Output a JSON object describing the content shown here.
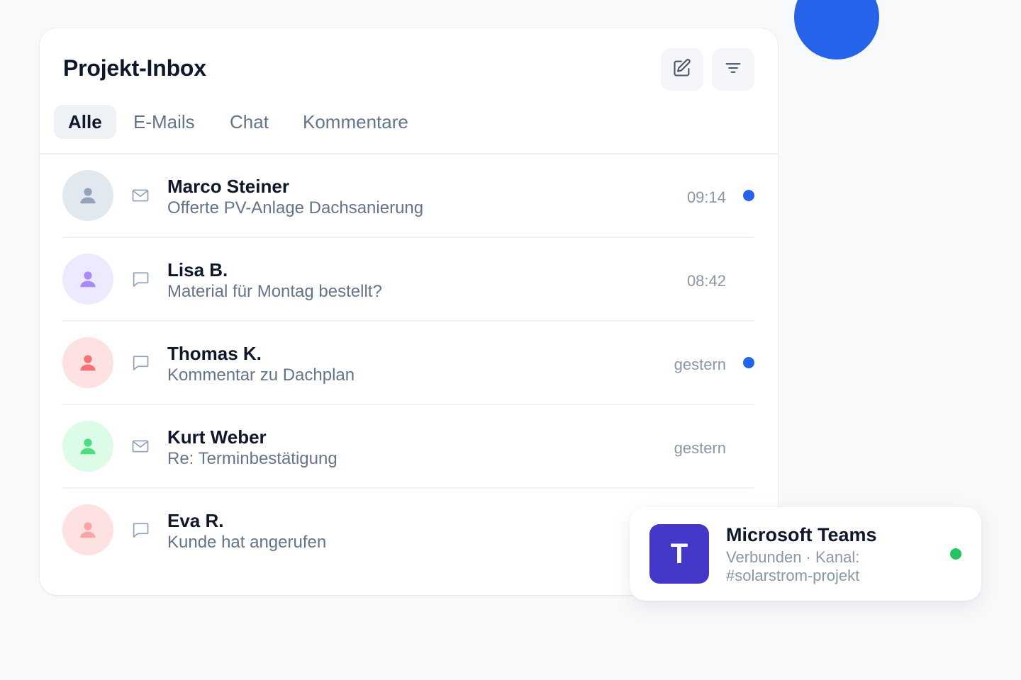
{
  "header": {
    "title": "Projekt-Inbox",
    "compose_icon": "compose-icon",
    "filter_icon": "filter-icon"
  },
  "tabs": [
    {
      "label": "Alle",
      "active": true
    },
    {
      "label": "E-Mails",
      "active": false
    },
    {
      "label": "Chat",
      "active": false
    },
    {
      "label": "Kommentare",
      "active": false
    }
  ],
  "messages": [
    {
      "name": "Marco Steiner",
      "subject": "Offerte PV-Anlage Dachsanierung",
      "time": "09:14",
      "unread": true,
      "type": "email",
      "type_icon": "mail-icon",
      "avatar_bg": "#e2e8f0",
      "avatar_fg": "#94a3b8"
    },
    {
      "name": "Lisa B.",
      "subject": "Material für Montag bestellt?",
      "time": "08:42",
      "unread": false,
      "type": "chat",
      "type_icon": "chat-bubble-icon",
      "avatar_bg": "#ede9fe",
      "avatar_fg": "#a78bfa"
    },
    {
      "name": "Thomas K.",
      "subject": "Kommentar zu Dachplan",
      "time": "gestern",
      "unread": true,
      "type": "chat",
      "type_icon": "chat-bubble-icon",
      "avatar_bg": "#fee2e2",
      "avatar_fg": "#f87171"
    },
    {
      "name": "Kurt Weber",
      "subject": "Re: Terminbestätigung",
      "time": "gestern",
      "unread": false,
      "type": "email",
      "type_icon": "mail-icon",
      "avatar_bg": "#dcfce7",
      "avatar_fg": "#4ade80"
    },
    {
      "name": "Eva R.",
      "subject": "Kunde hat angerufen",
      "time": "",
      "unread": false,
      "type": "chat",
      "type_icon": "chat-bubble-icon",
      "avatar_bg": "#fee2e2",
      "avatar_fg": "#fca5a5"
    }
  ],
  "integration": {
    "logo_letter": "T",
    "title": "Microsoft Teams",
    "status": "Verbunden · Kanal: #solarstrom-projekt",
    "connected": true
  },
  "colors": {
    "accent": "#2563eb",
    "teams": "#4338ca",
    "online": "#22c55e"
  }
}
